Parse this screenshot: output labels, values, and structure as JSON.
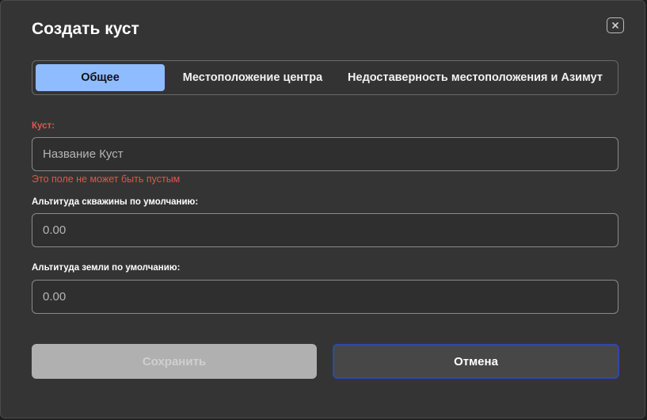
{
  "dialog": {
    "title": "Создать куст",
    "close_icon": "close-icon"
  },
  "tabs": [
    {
      "label": "Общее",
      "active": true
    },
    {
      "label": "Местоположение центра",
      "active": false
    },
    {
      "label": "Недоставерность местоположения и Азимут",
      "active": false
    }
  ],
  "form": {
    "bush": {
      "label": "Куст:",
      "placeholder": "Название Куст",
      "value": "",
      "error": "Это поле не может быть пустым"
    },
    "well_altitude": {
      "label": "Альтитуда скважины по умолчанию:",
      "placeholder": "0.00",
      "value": ""
    },
    "ground_altitude": {
      "label": "Альтитуда земли по умолчанию:",
      "placeholder": "0.00",
      "value": ""
    }
  },
  "buttons": {
    "save": "Сохранить",
    "cancel": "Отмена"
  },
  "colors": {
    "active_tab": "#8fbcff",
    "error": "#e0554f",
    "cancel_border": "#2f49a8",
    "save_disabled": "#b0b0b0"
  }
}
